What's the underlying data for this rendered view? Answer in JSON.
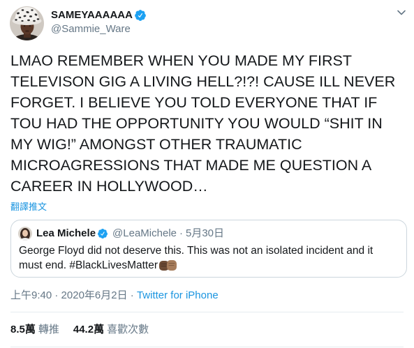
{
  "tweet": {
    "author": {
      "display_name": "SAMEYAAAAAA",
      "handle": "@Sammie_Ware",
      "verified": true
    },
    "text": "LMAO REMEMBER WHEN YOU MADE MY FIRST TELEVISON GIG A LIVING HELL?!?! CAUSE ILL NEVER FORGET. I BELIEVE YOU TOLD EVERYONE THAT IF TOU HAD THE OPPORTUNITY YOU WOULD “SHIT IN MY WIG!” AMONGST OTHER TRAUMATIC MICROAGRESSIONS THAT MADE ME QUESTION A CAREER IN HOLLYWOOD…",
    "translate_label": "翻譯推文",
    "quoted_tweet": {
      "author": {
        "display_name": "Lea Michele",
        "handle": "@LeaMichele",
        "verified": true
      },
      "separator": "·",
      "date": "5月30日",
      "text": "George Floyd did not deserve this. This was not an isolated incident and it must end. #BlackLivesMatter",
      "emoji_icon": "raised-fists-emoji-icon"
    },
    "meta": {
      "time": "上午9:40",
      "separator": "·",
      "date": "2020年6月2日",
      "source": "Twitter for iPhone"
    },
    "stats": {
      "retweets_count": "8.5萬",
      "retweets_label": "轉推",
      "likes_count": "44.2萬",
      "likes_label": "喜歡次數"
    }
  },
  "icons": {
    "verified": "verified-badge-icon",
    "more_options": "chevron-down-icon",
    "emoji": "raised-fists-emoji-icon"
  },
  "colors": {
    "text_primary": "#14171a",
    "text_secondary": "#657786",
    "link": "#1b95e0",
    "verified_badge": "#1da1f2",
    "border": "#ccd6dd",
    "divider": "#e6ecf0"
  }
}
